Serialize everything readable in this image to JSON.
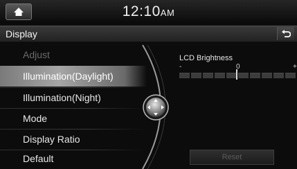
{
  "status_bar": {
    "time": "12:10",
    "ampm": "AM"
  },
  "header": {
    "title": "Display"
  },
  "menu": {
    "items": [
      {
        "label": "Adjust",
        "state": "disabled"
      },
      {
        "label": "Illumination(Daylight)",
        "state": "selected"
      },
      {
        "label": "Illumination(Night)",
        "state": "normal"
      },
      {
        "label": "Mode",
        "state": "normal"
      },
      {
        "label": "Display Ratio",
        "state": "normal"
      },
      {
        "label": "Default",
        "state": "normal"
      }
    ]
  },
  "brightness": {
    "label": "LCD Brightness",
    "min_label": "-",
    "mid_label": "0",
    "max_label": "+",
    "value": 0,
    "range": [
      -5,
      5
    ]
  },
  "reset_label": "Reset",
  "colors": {
    "background": "#0c0c0c",
    "selected": "#a6a6a6",
    "disabled_text": "#6a6a6a"
  },
  "icons": {
    "home": "home-icon",
    "back": "back-arrow-icon",
    "jog": "jog-dial-icon"
  }
}
